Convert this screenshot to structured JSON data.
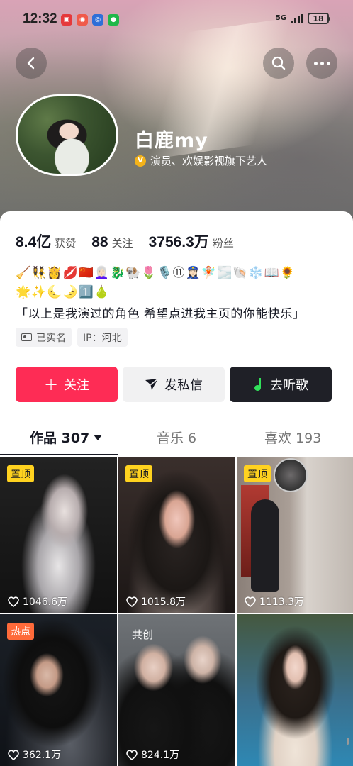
{
  "status_bar": {
    "time": "12:32",
    "network": "5G",
    "battery": "18"
  },
  "profile": {
    "name": "白鹿my",
    "verification": "演员、欢娱影视旗下艺人",
    "stats": [
      {
        "value": "8.4亿",
        "label": "获赞"
      },
      {
        "value": "88",
        "label": "关注"
      },
      {
        "value": "3756.3万",
        "label": "粉丝"
      }
    ],
    "emoji_line_1": "🧹👯‍♀️👸💋🇨🇳👩🏻‍🦳🐉🐏🌷🎙️⑪👮🏻‍♀️🧚🏻🌫️🐚❄️📖🌻",
    "emoji_line_2": "🌟✨🌜🌛1️⃣🍐",
    "bio": "「以上是我演过的角色 希望点进我主页的你能快乐」",
    "tags": {
      "real_name": "已实名",
      "ip": "IP：河北"
    }
  },
  "actions": {
    "follow": "关注",
    "message": "发私信",
    "music": "去听歌"
  },
  "tabs": {
    "works": "作品 307",
    "music": "音乐 6",
    "likes": "喜欢 193"
  },
  "videos": [
    {
      "badge": "置顶",
      "likes": "1046.6万"
    },
    {
      "badge": "置顶",
      "likes": "1015.8万"
    },
    {
      "badge": "置顶",
      "likes": "1113.3万"
    },
    {
      "badge": "热点",
      "likes": "362.1万"
    },
    {
      "badge": "共创",
      "likes": "824.1万"
    },
    {
      "badge": "",
      "likes": ""
    }
  ],
  "colors": {
    "accent": "#fe2c55",
    "pin_badge": "#ffd21f",
    "hot_badge": "#fe6a3a",
    "music_button": "#1f2027"
  }
}
